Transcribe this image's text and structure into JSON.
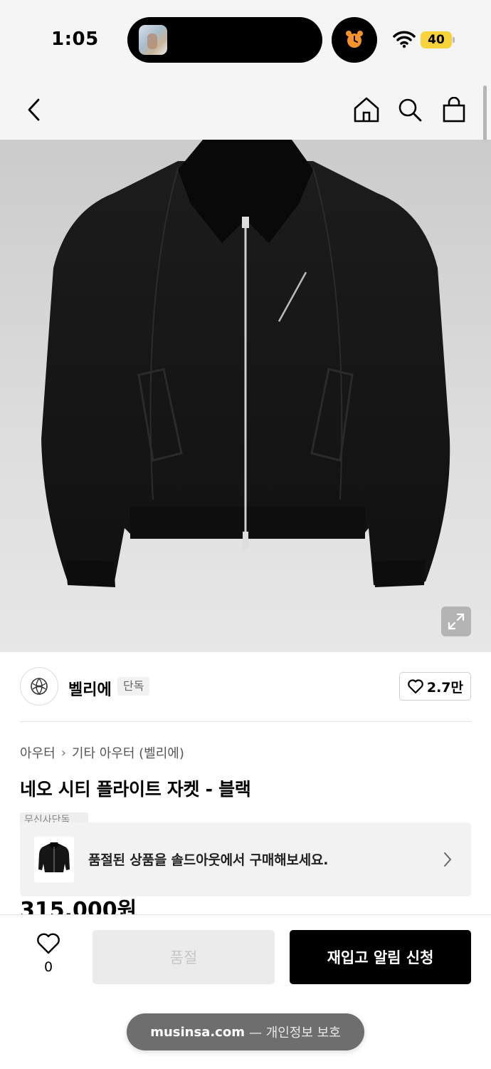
{
  "status_bar": {
    "time": "1:05",
    "battery": "40",
    "alarm_icon": "alarm-clock-icon",
    "wifi_icon": "wifi-icon"
  },
  "nav": {
    "back_icon": "chevron-left-icon",
    "home_icon": "home-icon",
    "search_icon": "search-icon",
    "cart_icon": "shopping-bag-icon"
  },
  "product": {
    "brand_name": "벨리에",
    "exclusive_badge": "단독",
    "like_count": "2.7만",
    "breadcrumb": [
      "아우터",
      "기타 아우터 (벨리에)"
    ],
    "title": "네오 시티 플라이트 자켓 - 블랙",
    "partial_tag": "무신사단독",
    "price_partial": "315,000원"
  },
  "soldout_banner": {
    "text": "품절된 상품을 솔드아웃에서 구매해보세요."
  },
  "bottom_bar": {
    "wish_count": "0",
    "soldout_label": "품절",
    "restock_label": "재입고 알림 신청"
  },
  "url_bar": {
    "domain": "musinsa.com",
    "note": "— 개인정보 보호"
  },
  "colors": {
    "accent": "#000000",
    "battery": "#f7d43a",
    "alarm": "#f5922b"
  }
}
